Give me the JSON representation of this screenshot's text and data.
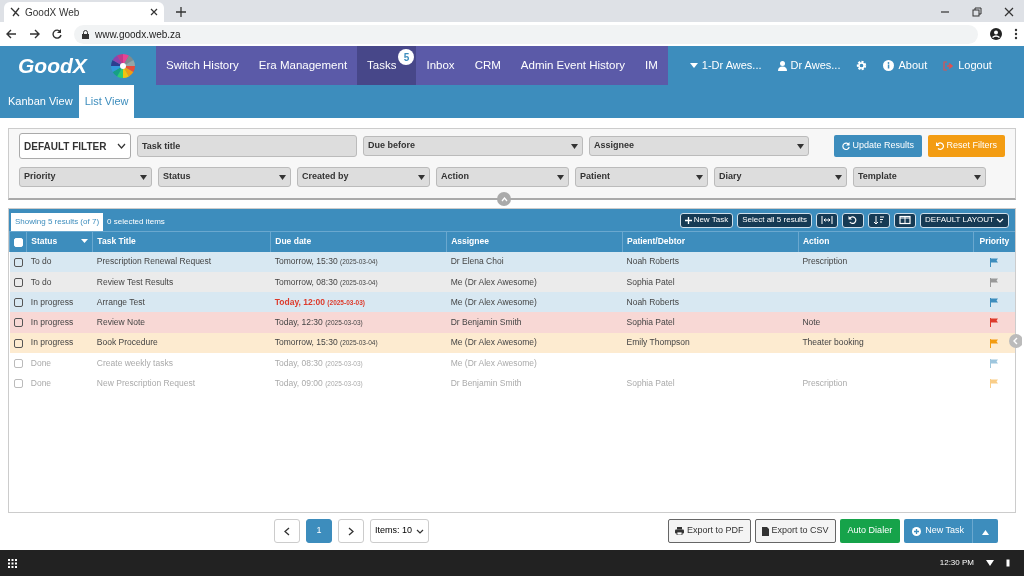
{
  "browser": {
    "tab_title": "GoodX Web",
    "address": "www.goodx.web.za"
  },
  "app": {
    "logo": "GoodX",
    "nav": [
      {
        "label": "Switch History",
        "selected": false
      },
      {
        "label": "Era Management",
        "selected": false
      },
      {
        "label": "Tasks",
        "selected": true,
        "badge": "5"
      },
      {
        "label": "Inbox",
        "selected": false
      },
      {
        "label": "CRM",
        "selected": false
      },
      {
        "label": "Admin Event History",
        "selected": false
      },
      {
        "label": "IM",
        "selected": false
      }
    ],
    "user_menu": [
      {
        "label": "1-Dr Awes...",
        "kind": "caret"
      },
      {
        "label": "Dr Awes...",
        "kind": "user"
      },
      {
        "kind": "gear"
      },
      {
        "label": "About",
        "kind": "info"
      },
      {
        "label": "Logout",
        "kind": "logout"
      }
    ],
    "views": [
      {
        "label": "Kanban View",
        "selected": false
      },
      {
        "label": "List View",
        "selected": true
      }
    ]
  },
  "filters": {
    "row_1": [
      {
        "kind": "preset",
        "label": "DEFAULT FILTER"
      },
      {
        "kind": "input",
        "placeholder": "Task title"
      },
      {
        "kind": "select",
        "label": "Due before"
      },
      {
        "kind": "select",
        "label": "Assignee"
      }
    ],
    "update_button": "Update Results",
    "reset_button": "Reset Filters",
    "row_2": [
      {
        "label": "Priority"
      },
      {
        "label": "Status"
      },
      {
        "label": "Created by"
      },
      {
        "label": "Action"
      },
      {
        "label": "Patient"
      },
      {
        "label": "Diary"
      },
      {
        "label": "Template"
      }
    ]
  },
  "table": {
    "result_tab": "Showing 5 results (of 7)",
    "selected_count": "0 selected items",
    "all_checked": false,
    "toolbar": {
      "new_task": "New Task",
      "select_all": "Select all 5 results",
      "layout": "DEFAULT LAYOUT"
    },
    "columns": [
      "Status",
      "Task Title",
      "Due date",
      "Assignee",
      "Patient/Debtor",
      "Action",
      "Priority"
    ],
    "rows": [
      {
        "checked": false,
        "completed": false,
        "overdue": false,
        "color": "#3d8dbd",
        "status": "To do",
        "title": "Prescription Renewal Request",
        "due": "Tomorrow, 15:30",
        "due_date": "(2025-03-04)",
        "assignee": "Dr Elena Choi",
        "patient": "Noah Roberts",
        "action": "Prescription"
      },
      {
        "checked": false,
        "completed": false,
        "overdue": false,
        "color": "#999999",
        "status": "To do",
        "title": "Review Test Results",
        "due": "Tomorrow, 08:30",
        "due_date": "(2025-03-04)",
        "assignee": "Me (Dr Alex Awesome)",
        "patient": "Sophia Patel"
      },
      {
        "checked": false,
        "completed": false,
        "overdue": true,
        "color": "#3d8dbd",
        "status": "In progress",
        "title": "Arrange Test",
        "due": "Today, 12:00",
        "due_date": "(2025-03-03)",
        "assignee": "Me (Dr Alex Awesome)",
        "patient": "Noah Roberts"
      },
      {
        "checked": false,
        "completed": false,
        "overdue": false,
        "color": "#dd3b2c",
        "status": "In progress",
        "title": "Review Note",
        "due": "Today, 12:30",
        "due_date": "(2025-03-03)",
        "assignee": "Dr Benjamin Smith",
        "patient": "Sophia Patel",
        "action": "Note"
      },
      {
        "checked": false,
        "completed": false,
        "overdue": false,
        "color": "#f39c12",
        "status": "In progress",
        "title": "Book Procedure",
        "due": "Tomorrow, 15:30",
        "due_date": "(2025-03-04)",
        "assignee": "Me (Dr Alex Awesome)",
        "patient": "Emily Thompson",
        "action": "Theater booking"
      },
      {
        "checked": false,
        "completed": true,
        "overdue": false,
        "color": "#9ec6de",
        "status": "Done",
        "title": "Create weekly tasks",
        "due": "Today, 08:30",
        "due_date": "(2025-03-03)",
        "assignee": "Me (Dr Alex Awesome)"
      },
      {
        "checked": false,
        "completed": true,
        "overdue": false,
        "color": "#f9cd88",
        "status": "Done",
        "title": "New Prescription Request",
        "due": "Today, 09:00",
        "due_date": "(2025-03-03)",
        "assignee": "Dr Benjamin Smith",
        "patient": "Sophia Patel",
        "action": "Prescription"
      }
    ]
  },
  "footer": {
    "pages": [
      {
        "label": "1",
        "selected": true
      }
    ],
    "items": "Items: 10",
    "export_pdf": "Export to PDF",
    "export_csv": "Export to CSV",
    "auto_dialer": "Auto Dialer",
    "new_task": "New Task"
  },
  "taskbar": {
    "time": "12:30 PM"
  }
}
